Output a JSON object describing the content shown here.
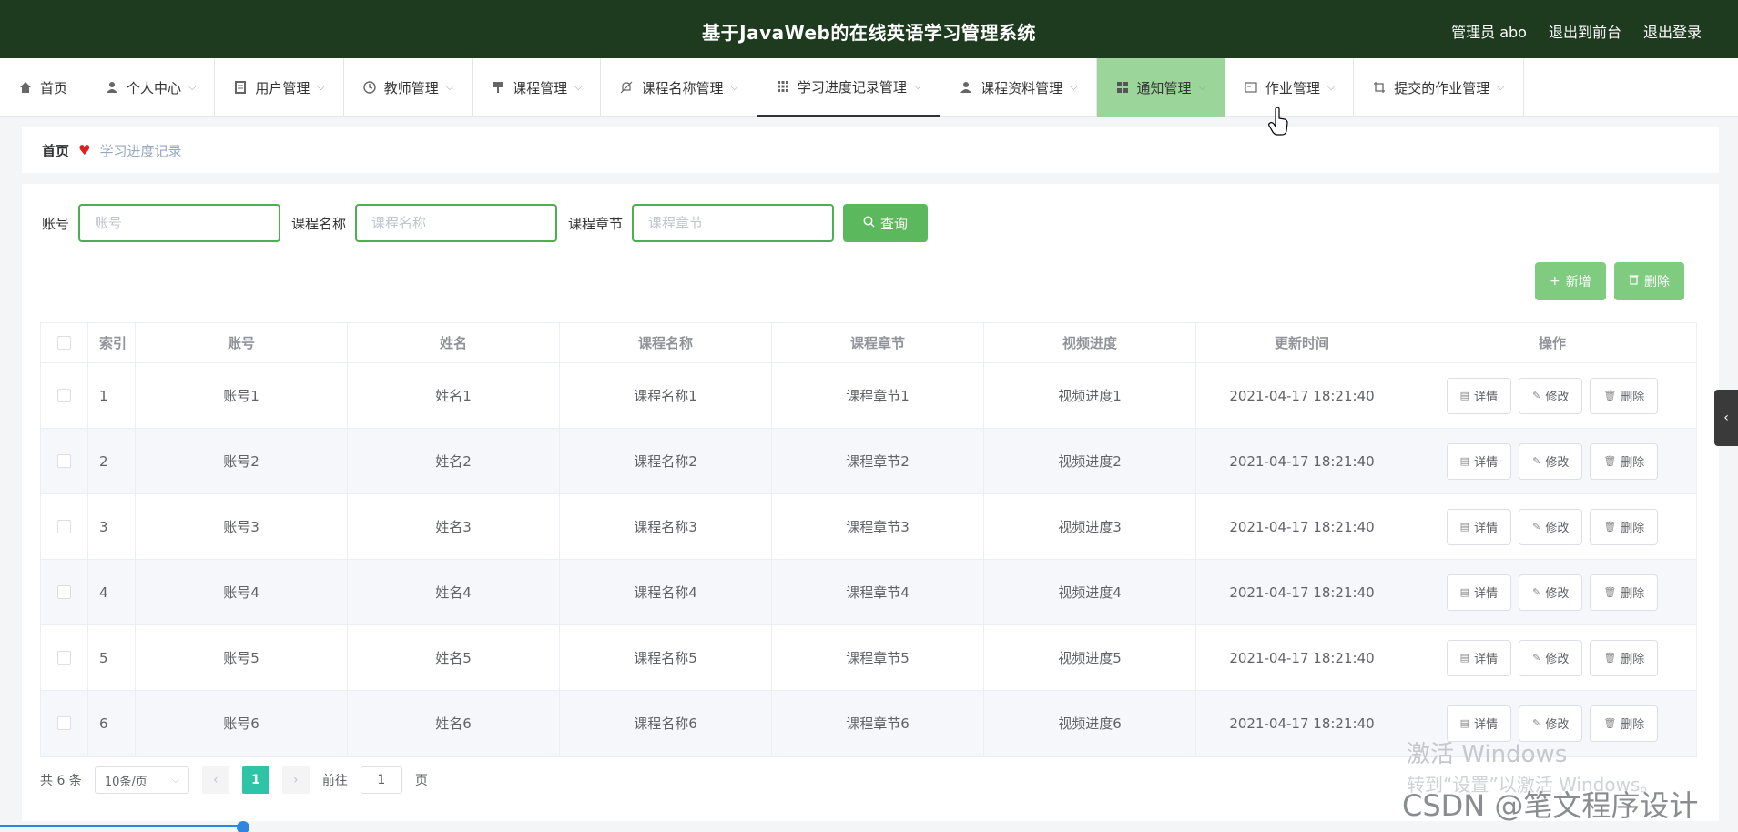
{
  "header": {
    "title": "基于JavaWeb的在线英语学习管理系统",
    "user": "管理员 abo",
    "to_front": "退出到前台",
    "logout": "退出登录"
  },
  "nav": {
    "items": [
      {
        "label": "首页",
        "icon": "home-icon"
      },
      {
        "label": "个人中心",
        "icon": "user-icon"
      },
      {
        "label": "用户管理",
        "icon": "document-icon"
      },
      {
        "label": "教师管理",
        "icon": "clock-icon"
      },
      {
        "label": "课程管理",
        "icon": "pin-icon"
      },
      {
        "label": "课程名称管理",
        "icon": "bell-off-icon"
      },
      {
        "label": "学习进度记录管理",
        "icon": "grid-icon"
      },
      {
        "label": "课程资料管理",
        "icon": "user-icon"
      },
      {
        "label": "通知管理",
        "icon": "grid-icon"
      },
      {
        "label": "作业管理",
        "icon": "card-icon"
      },
      {
        "label": "提交的作业管理",
        "icon": "crop-icon"
      }
    ]
  },
  "breadcrumb": {
    "home": "首页",
    "current": "学习进度记录"
  },
  "search": {
    "account_label": "账号",
    "account_placeholder": "账号",
    "account_value": "",
    "course_label": "课程名称",
    "course_placeholder": "课程名称",
    "course_value": "",
    "chapter_label": "课程章节",
    "chapter_placeholder": "课程章节",
    "chapter_value": "",
    "query": "查询"
  },
  "actions": {
    "add": "新增",
    "delete": "删除"
  },
  "table": {
    "headers": [
      "索引",
      "账号",
      "姓名",
      "课程名称",
      "课程章节",
      "视频进度",
      "更新时间",
      "操作"
    ],
    "rows": [
      [
        "1",
        "账号1",
        "姓名1",
        "课程名称1",
        "课程章节1",
        "视频进度1",
        "2021-04-17 18:21:40"
      ],
      [
        "2",
        "账号2",
        "姓名2",
        "课程名称2",
        "课程章节2",
        "视频进度2",
        "2021-04-17 18:21:40"
      ],
      [
        "3",
        "账号3",
        "姓名3",
        "课程名称3",
        "课程章节3",
        "视频进度3",
        "2021-04-17 18:21:40"
      ],
      [
        "4",
        "账号4",
        "姓名4",
        "课程名称4",
        "课程章节4",
        "视频进度4",
        "2021-04-17 18:21:40"
      ],
      [
        "5",
        "账号5",
        "姓名5",
        "课程名称5",
        "课程章节5",
        "视频进度5",
        "2021-04-17 18:21:40"
      ],
      [
        "6",
        "账号6",
        "姓名6",
        "课程名称6",
        "课程章节6",
        "视频进度6",
        "2021-04-17 18:21:40"
      ]
    ],
    "op_detail": "详情",
    "op_edit": "修改",
    "op_delete": "删除"
  },
  "pager": {
    "total": "共 6 条",
    "size": "10条/页",
    "page": "1",
    "goto_prefix": "前往",
    "goto_value": "1",
    "goto_suffix": "页"
  },
  "watermark": {
    "line1": "激活 Windows",
    "line2": "转到“设置”以激活 Windows。",
    "csdn": "CSDN @笔文程序设计"
  },
  "colors": {
    "header_bg": "#1e3b1f",
    "primary_green": "#5cb85c",
    "nav_hover": "#9bd59a",
    "page_active": "#2ec4a6"
  }
}
